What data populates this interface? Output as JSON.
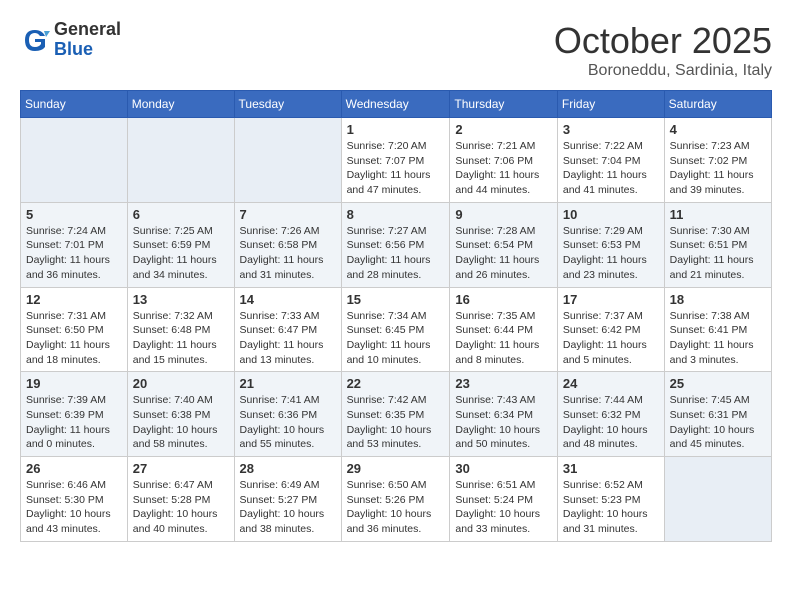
{
  "header": {
    "logo": {
      "general": "General",
      "blue": "Blue"
    },
    "title": "October 2025",
    "location": "Boroneddu, Sardinia, Italy"
  },
  "weekdays": [
    "Sunday",
    "Monday",
    "Tuesday",
    "Wednesday",
    "Thursday",
    "Friday",
    "Saturday"
  ],
  "weeks": [
    [
      {
        "day": "",
        "info": ""
      },
      {
        "day": "",
        "info": ""
      },
      {
        "day": "",
        "info": ""
      },
      {
        "day": "1",
        "info": "Sunrise: 7:20 AM\nSunset: 7:07 PM\nDaylight: 11 hours and 47 minutes."
      },
      {
        "day": "2",
        "info": "Sunrise: 7:21 AM\nSunset: 7:06 PM\nDaylight: 11 hours and 44 minutes."
      },
      {
        "day": "3",
        "info": "Sunrise: 7:22 AM\nSunset: 7:04 PM\nDaylight: 11 hours and 41 minutes."
      },
      {
        "day": "4",
        "info": "Sunrise: 7:23 AM\nSunset: 7:02 PM\nDaylight: 11 hours and 39 minutes."
      }
    ],
    [
      {
        "day": "5",
        "info": "Sunrise: 7:24 AM\nSunset: 7:01 PM\nDaylight: 11 hours and 36 minutes."
      },
      {
        "day": "6",
        "info": "Sunrise: 7:25 AM\nSunset: 6:59 PM\nDaylight: 11 hours and 34 minutes."
      },
      {
        "day": "7",
        "info": "Sunrise: 7:26 AM\nSunset: 6:58 PM\nDaylight: 11 hours and 31 minutes."
      },
      {
        "day": "8",
        "info": "Sunrise: 7:27 AM\nSunset: 6:56 PM\nDaylight: 11 hours and 28 minutes."
      },
      {
        "day": "9",
        "info": "Sunrise: 7:28 AM\nSunset: 6:54 PM\nDaylight: 11 hours and 26 minutes."
      },
      {
        "day": "10",
        "info": "Sunrise: 7:29 AM\nSunset: 6:53 PM\nDaylight: 11 hours and 23 minutes."
      },
      {
        "day": "11",
        "info": "Sunrise: 7:30 AM\nSunset: 6:51 PM\nDaylight: 11 hours and 21 minutes."
      }
    ],
    [
      {
        "day": "12",
        "info": "Sunrise: 7:31 AM\nSunset: 6:50 PM\nDaylight: 11 hours and 18 minutes."
      },
      {
        "day": "13",
        "info": "Sunrise: 7:32 AM\nSunset: 6:48 PM\nDaylight: 11 hours and 15 minutes."
      },
      {
        "day": "14",
        "info": "Sunrise: 7:33 AM\nSunset: 6:47 PM\nDaylight: 11 hours and 13 minutes."
      },
      {
        "day": "15",
        "info": "Sunrise: 7:34 AM\nSunset: 6:45 PM\nDaylight: 11 hours and 10 minutes."
      },
      {
        "day": "16",
        "info": "Sunrise: 7:35 AM\nSunset: 6:44 PM\nDaylight: 11 hours and 8 minutes."
      },
      {
        "day": "17",
        "info": "Sunrise: 7:37 AM\nSunset: 6:42 PM\nDaylight: 11 hours and 5 minutes."
      },
      {
        "day": "18",
        "info": "Sunrise: 7:38 AM\nSunset: 6:41 PM\nDaylight: 11 hours and 3 minutes."
      }
    ],
    [
      {
        "day": "19",
        "info": "Sunrise: 7:39 AM\nSunset: 6:39 PM\nDaylight: 11 hours and 0 minutes."
      },
      {
        "day": "20",
        "info": "Sunrise: 7:40 AM\nSunset: 6:38 PM\nDaylight: 10 hours and 58 minutes."
      },
      {
        "day": "21",
        "info": "Sunrise: 7:41 AM\nSunset: 6:36 PM\nDaylight: 10 hours and 55 minutes."
      },
      {
        "day": "22",
        "info": "Sunrise: 7:42 AM\nSunset: 6:35 PM\nDaylight: 10 hours and 53 minutes."
      },
      {
        "day": "23",
        "info": "Sunrise: 7:43 AM\nSunset: 6:34 PM\nDaylight: 10 hours and 50 minutes."
      },
      {
        "day": "24",
        "info": "Sunrise: 7:44 AM\nSunset: 6:32 PM\nDaylight: 10 hours and 48 minutes."
      },
      {
        "day": "25",
        "info": "Sunrise: 7:45 AM\nSunset: 6:31 PM\nDaylight: 10 hours and 45 minutes."
      }
    ],
    [
      {
        "day": "26",
        "info": "Sunrise: 6:46 AM\nSunset: 5:30 PM\nDaylight: 10 hours and 43 minutes."
      },
      {
        "day": "27",
        "info": "Sunrise: 6:47 AM\nSunset: 5:28 PM\nDaylight: 10 hours and 40 minutes."
      },
      {
        "day": "28",
        "info": "Sunrise: 6:49 AM\nSunset: 5:27 PM\nDaylight: 10 hours and 38 minutes."
      },
      {
        "day": "29",
        "info": "Sunrise: 6:50 AM\nSunset: 5:26 PM\nDaylight: 10 hours and 36 minutes."
      },
      {
        "day": "30",
        "info": "Sunrise: 6:51 AM\nSunset: 5:24 PM\nDaylight: 10 hours and 33 minutes."
      },
      {
        "day": "31",
        "info": "Sunrise: 6:52 AM\nSunset: 5:23 PM\nDaylight: 10 hours and 31 minutes."
      },
      {
        "day": "",
        "info": ""
      }
    ]
  ]
}
